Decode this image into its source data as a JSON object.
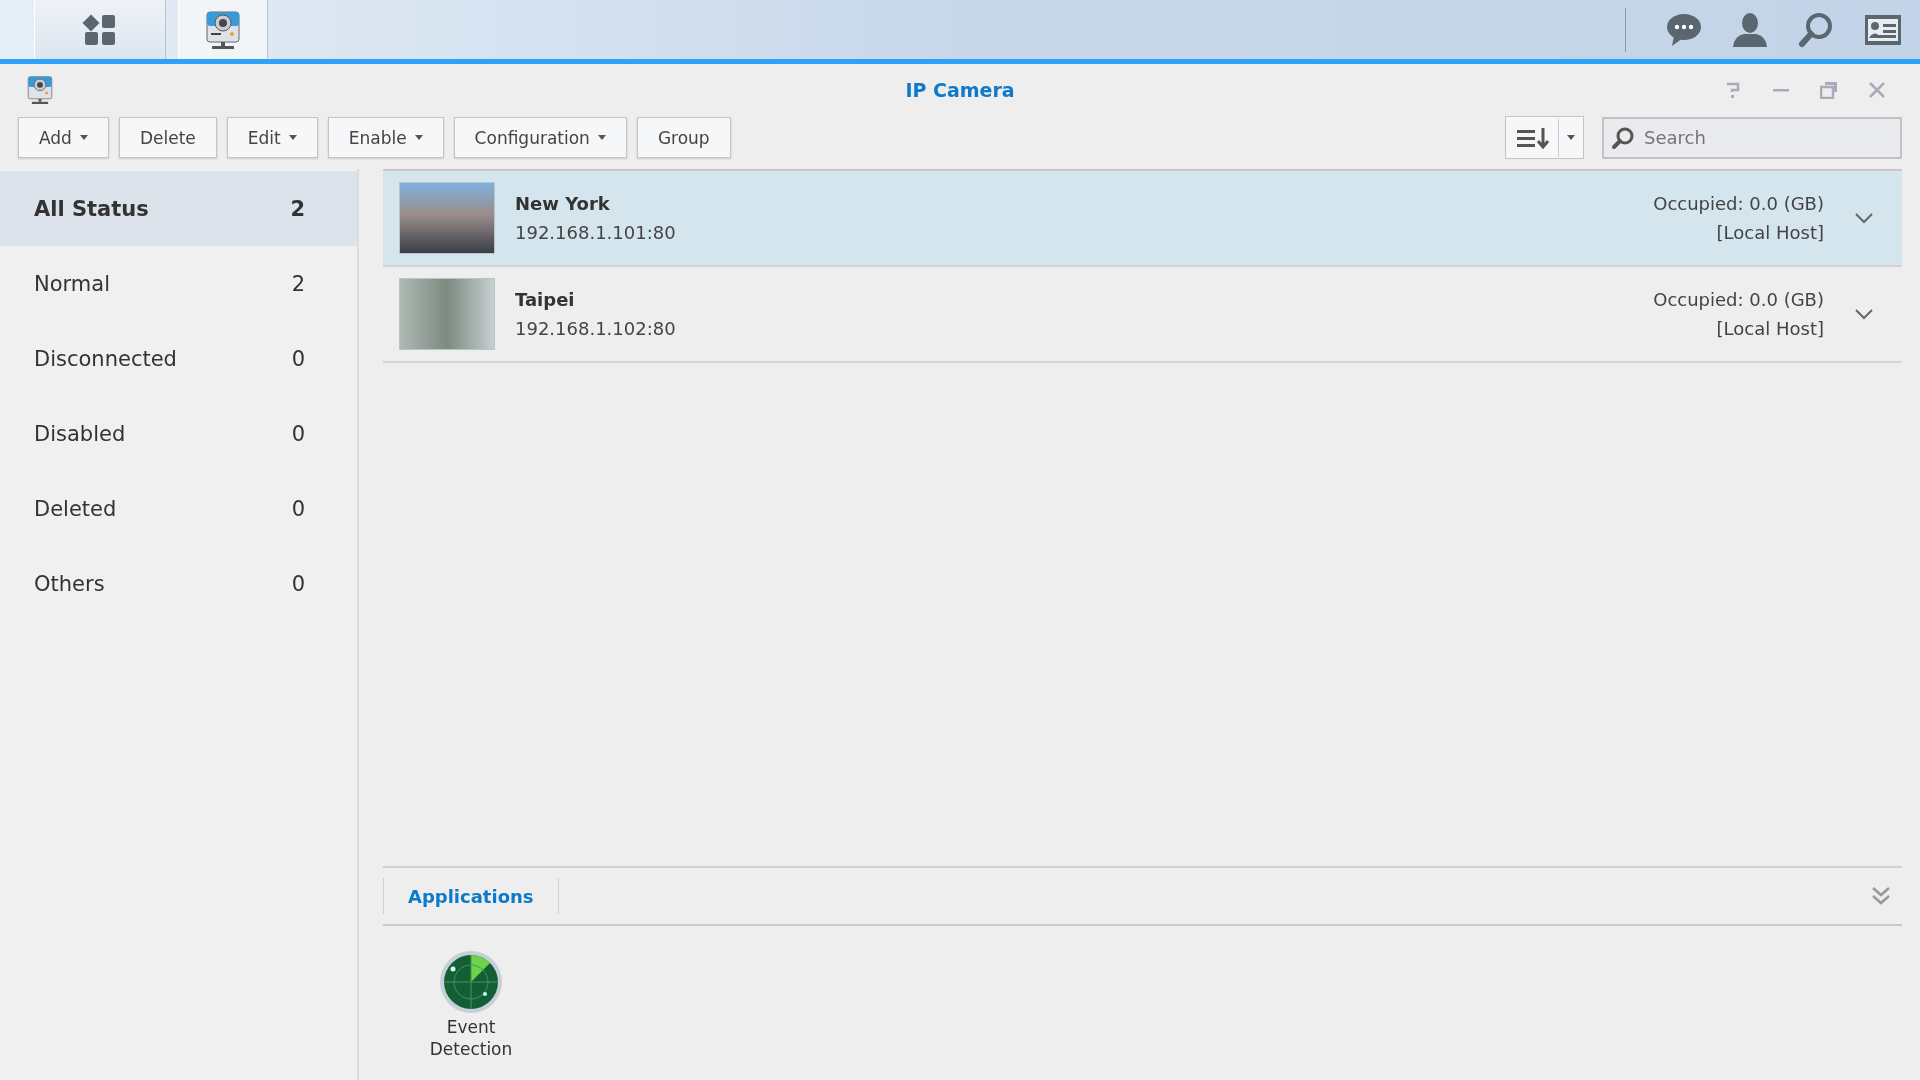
{
  "window": {
    "title": "IP Camera"
  },
  "toolbar": {
    "buttons": [
      {
        "label": "Add",
        "dropdown": true
      },
      {
        "label": "Delete",
        "dropdown": false
      },
      {
        "label": "Edit",
        "dropdown": true
      },
      {
        "label": "Enable",
        "dropdown": true
      },
      {
        "label": "Configuration",
        "dropdown": true
      },
      {
        "label": "Group",
        "dropdown": false
      }
    ],
    "search": {
      "placeholder": "Search"
    }
  },
  "sidebar": {
    "items": [
      {
        "label": "All Status",
        "count": "2",
        "selected": true
      },
      {
        "label": "Normal",
        "count": "2",
        "selected": false
      },
      {
        "label": "Disconnected",
        "count": "0",
        "selected": false
      },
      {
        "label": "Disabled",
        "count": "0",
        "selected": false
      },
      {
        "label": "Deleted",
        "count": "0",
        "selected": false
      },
      {
        "label": "Others",
        "count": "0",
        "selected": false
      }
    ]
  },
  "cameras": [
    {
      "name": "New York",
      "address": "192.168.1.101:80",
      "occupied": "Occupied: 0.0 (GB)",
      "host": "[Local Host]",
      "selected": true
    },
    {
      "name": "Taipei",
      "address": "192.168.1.102:80",
      "occupied": "Occupied: 0.0 (GB)",
      "host": "[Local Host]",
      "selected": false
    }
  ],
  "panel": {
    "tabs": [
      {
        "label": "Applications",
        "selected": true
      }
    ],
    "apps": [
      {
        "label": "Event Detection"
      }
    ]
  }
}
